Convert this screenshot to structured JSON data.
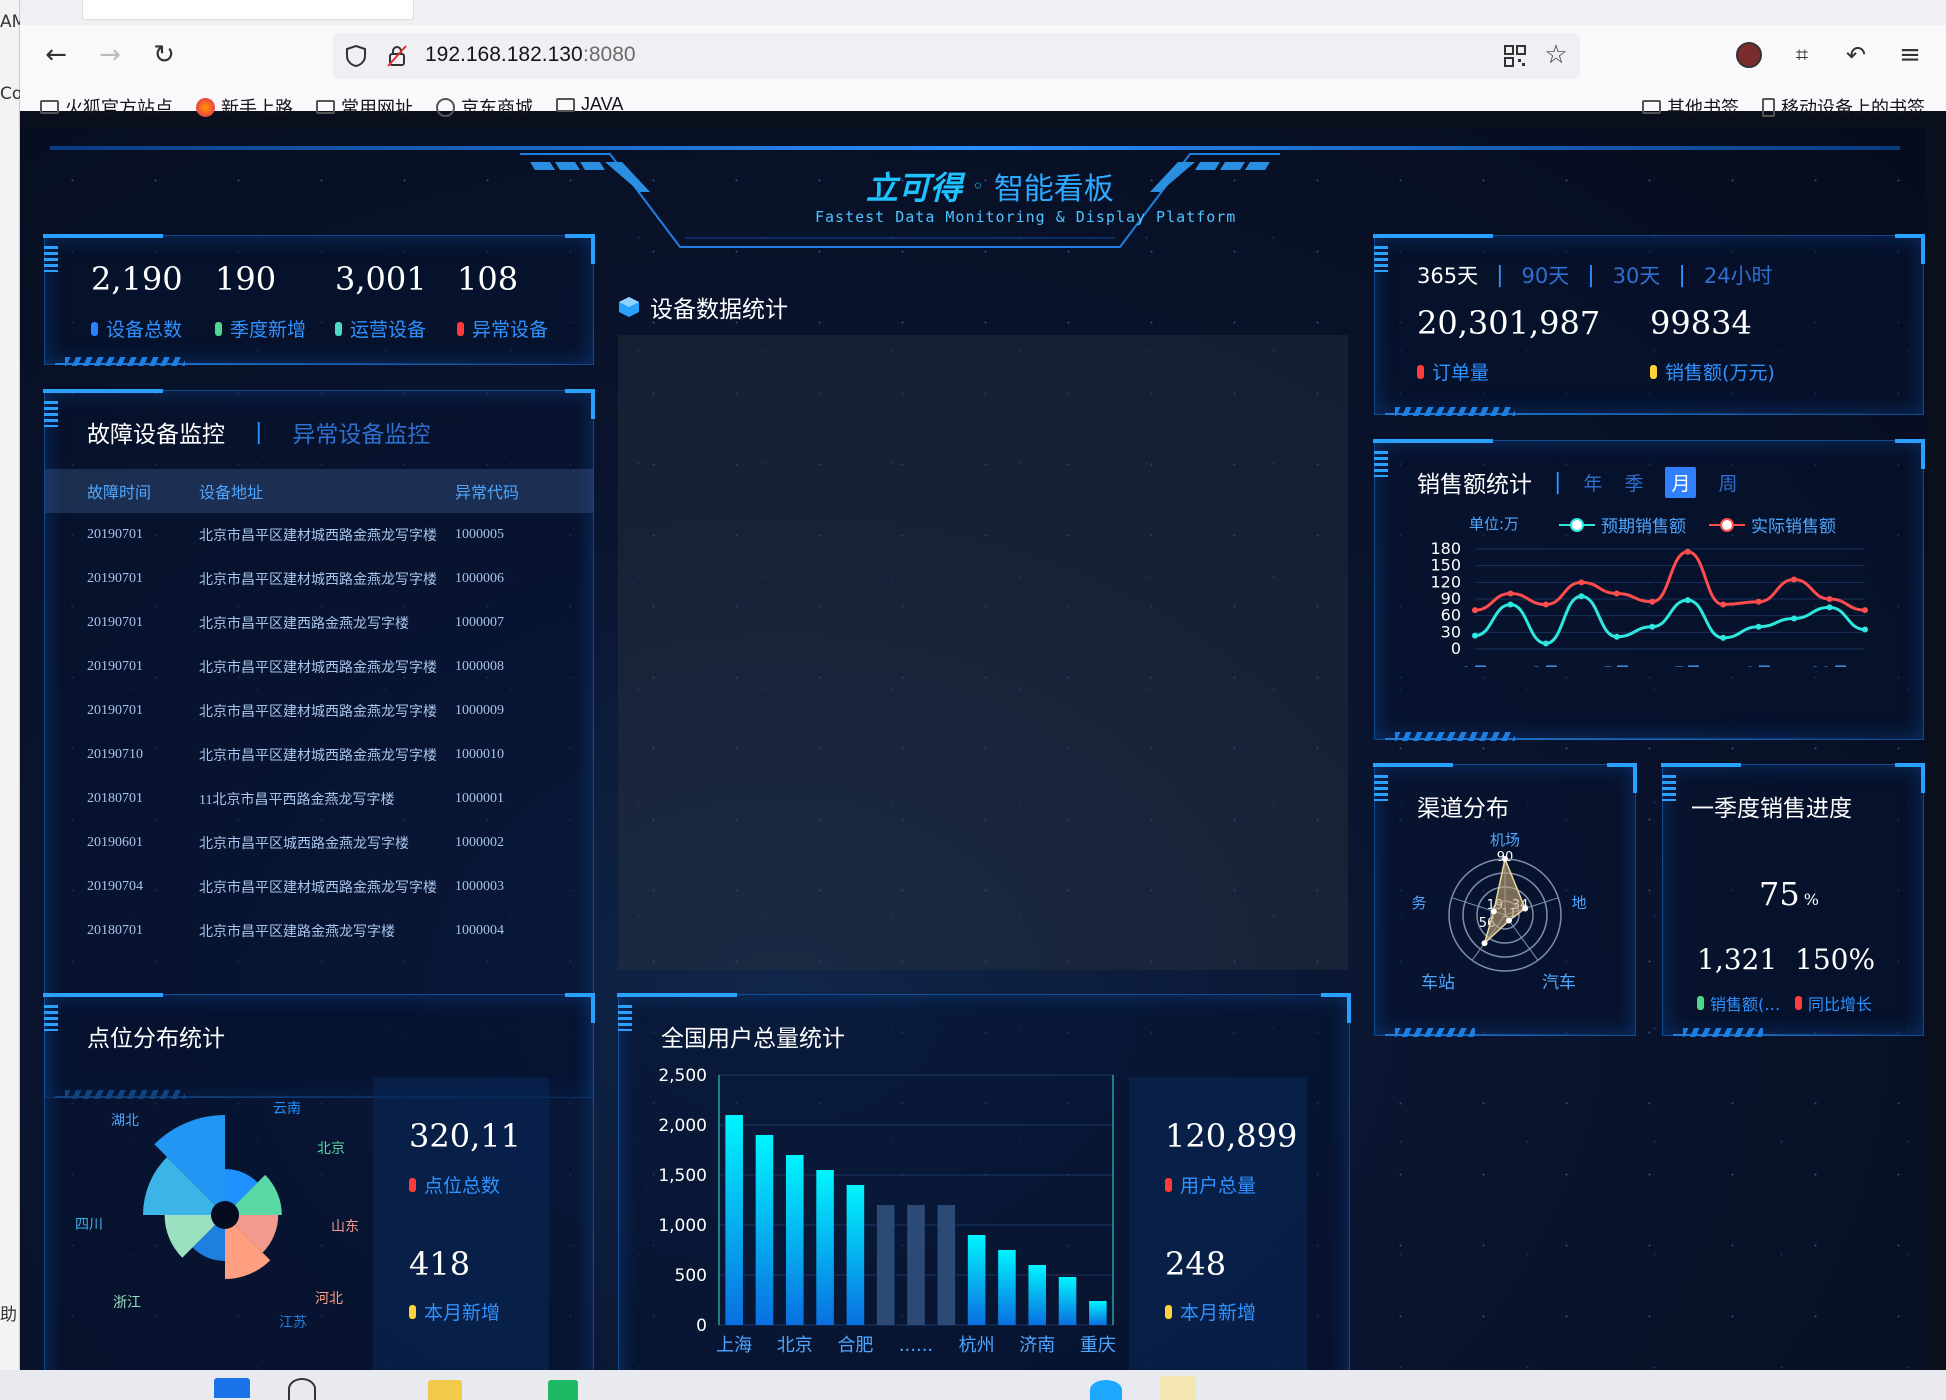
{
  "browser": {
    "url_host": "192.168.182.130",
    "url_port": ":8080",
    "left_strip": [
      "AM",
      "Co",
      "助"
    ],
    "bookmarks": [
      "火狐官方站点",
      "新手上路",
      "常用网址",
      "京东商城",
      "JAVA"
    ],
    "bookmarks_right": [
      "其他书签",
      "移动设备上的书签"
    ]
  },
  "header": {
    "logo": "立可得",
    "title": "智能看板",
    "subtitle": "Fastest Data Monitoring & Display Platform"
  },
  "overview": {
    "items": [
      {
        "value": "2,190",
        "label": "设备总数",
        "color": "#2a7fff"
      },
      {
        "value": "190",
        "label": "季度新增",
        "color": "#4fd88a"
      },
      {
        "value": "3,001",
        "label": "运营设备",
        "color": "#4fd8c8"
      },
      {
        "value": "108",
        "label": "异常设备",
        "color": "#ff3b3b"
      }
    ]
  },
  "monitor": {
    "tab_active": "故障设备监控",
    "tab_inactive": "异常设备监控",
    "headers": [
      "故障时间",
      "设备地址",
      "异常代码"
    ],
    "rows": [
      [
        "20190701",
        "北京市昌平区建材城西路金燕龙写字楼",
        "1000005"
      ],
      [
        "20190701",
        "北京市昌平区建材城西路金燕龙写字楼",
        "1000006"
      ],
      [
        "20190701",
        "北京市昌平区建西路金燕龙写字楼",
        "1000007"
      ],
      [
        "20190701",
        "北京市昌平区建材城西路金燕龙写字楼",
        "1000008"
      ],
      [
        "20190701",
        "北京市昌平区建材城西路金燕龙写字楼",
        "1000009"
      ],
      [
        "20190710",
        "北京市昌平区建材城西路金燕龙写字楼",
        "1000010"
      ],
      [
        "20180701",
        "11北京市昌平西路金燕龙写字楼",
        "1000001"
      ],
      [
        "20190601",
        "北京市昌平区城西路金燕龙写字楼",
        "1000002"
      ],
      [
        "20190704",
        "北京市昌平区建材城西路金燕龙写字楼",
        "1000003"
      ],
      [
        "20180701",
        "北京市昌平区建路金燕龙写字楼",
        "1000004"
      ]
    ]
  },
  "device_stats": {
    "title": "设备数据统计"
  },
  "points": {
    "title": "点位分布统计",
    "total_value": "320,11",
    "total_label": "点位总数",
    "new_value": "418",
    "new_label": "本月新增",
    "labels": [
      "湖北",
      "云南",
      "北京",
      "山东",
      "河北",
      "江苏",
      "浙江",
      "四川"
    ]
  },
  "users": {
    "title": "全国用户总量统计",
    "total_value": "120,899",
    "total_label": "用户总量",
    "new_value": "248",
    "new_label": "本月新增"
  },
  "orders": {
    "tabs": [
      "365天",
      "90天",
      "30天",
      "24小时"
    ],
    "orders_value": "20,301,987",
    "orders_label": "订单量",
    "sales_value": "99834",
    "sales_label": "销售额(万元)"
  },
  "sales": {
    "title": "销售额统计",
    "tabs": [
      "年",
      "季",
      "月",
      "周"
    ],
    "active_tab": "月",
    "unit": "单位:万",
    "legend": [
      "预期销售额",
      "实际销售额"
    ]
  },
  "channel": {
    "title": "渠道分布",
    "labels": [
      "机场",
      "地",
      "汽车",
      "车站",
      "务"
    ],
    "tick": "90",
    "values": [
      "19",
      "34",
      "11",
      "56"
    ]
  },
  "quarter": {
    "title": "一季度销售进度",
    "percent_value": "75",
    "percent_unit": "%",
    "left_value": "1,321",
    "left_label": "销售额(…",
    "right_value": "150%",
    "right_label": "同比增长"
  },
  "chart_data": [
    {
      "type": "line",
      "title": "销售额统计",
      "x": [
        "1月",
        "2月",
        "3月",
        "4月",
        "5月",
        "6月",
        "7月",
        "8月",
        "9月",
        "10月",
        "11月",
        "12月"
      ],
      "xticks": [
        "1月",
        "3月",
        "5月",
        "7月",
        "9月",
        "11月"
      ],
      "yticks": [
        "180",
        "150",
        "120",
        "90",
        "60",
        "30",
        "0"
      ],
      "ylim": [
        0,
        180
      ],
      "series": [
        {
          "name": "预期销售额",
          "color": "#2ee8e0",
          "values": [
            24,
            80,
            10,
            95,
            22,
            40,
            88,
            20,
            40,
            55,
            75,
            35
          ]
        },
        {
          "name": "实际销售额",
          "color": "#ff4d4d",
          "values": [
            70,
            100,
            80,
            120,
            100,
            85,
            175,
            80,
            85,
            125,
            90,
            70
          ]
        }
      ]
    },
    {
      "type": "bar",
      "title": "全国用户总量统计",
      "categories": [
        "上海",
        "",
        "北京",
        "",
        "合肥",
        "",
        "......",
        "",
        "杭州",
        "",
        "济南",
        "",
        "重庆"
      ],
      "xticks": [
        "上海",
        "北京",
        "合肥",
        "......",
        "杭州",
        "济南",
        "重庆"
      ],
      "yticks": [
        "2,500",
        "2,000",
        "1,500",
        "1,000",
        "500",
        "0"
      ],
      "ylim": [
        0,
        2500
      ],
      "values": [
        2100,
        1900,
        1700,
        1550,
        1400,
        1200,
        1200,
        1200,
        900,
        750,
        600,
        480,
        240
      ]
    },
    {
      "type": "pie",
      "title": "点位分布统计",
      "categories": [
        "云南",
        "北京",
        "山东",
        "河北",
        "江苏",
        "浙江",
        "四川",
        "湖北"
      ],
      "values": [
        20,
        26,
        24,
        30,
        20,
        28,
        40,
        50
      ],
      "colors": [
        "#1e90ff",
        "#5ad8a6",
        "#f29a8d",
        "#ff9f7f",
        "#1e7fe0",
        "#9be0c0",
        "#3cb4e8",
        "#2196f3"
      ]
    },
    {
      "type": "radar",
      "title": "渠道分布",
      "indicators": [
        "机场",
        "地",
        "汽车",
        "车站",
        "务"
      ],
      "max": 90,
      "values": [
        90,
        34,
        11,
        56,
        19
      ]
    }
  ]
}
